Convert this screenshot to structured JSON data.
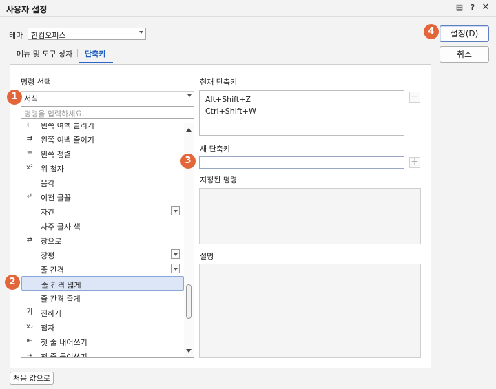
{
  "window": {
    "title": "사용자 설정"
  },
  "theme": {
    "label": "테마",
    "selected": "한컴오피스"
  },
  "tabs": [
    {
      "label": "메뉴 및 도구 상자"
    },
    {
      "label": "단축키"
    }
  ],
  "buttons": {
    "ok_label": "설정(D)",
    "cancel_label": "취소",
    "reset_label": "처음 값으로"
  },
  "left": {
    "command_select_label": "명령 선택",
    "category_selected": "서식",
    "search_placeholder": "명령을 입력하세요.",
    "commands": [
      {
        "label": "왼쪽 여백 늘리기",
        "icon": "indent-left-increase-icon",
        "glyph": "⇇",
        "dropdown": false
      },
      {
        "label": "왼쪽 여백 줄이기",
        "icon": "indent-left-decrease-icon",
        "glyph": "⇉",
        "dropdown": false
      },
      {
        "label": "왼쪽 정렬",
        "icon": "align-left-icon",
        "glyph": "≡",
        "dropdown": false
      },
      {
        "label": "위 첨자",
        "icon": "superscript-icon",
        "glyph": "x²",
        "dropdown": false
      },
      {
        "label": "음각",
        "icon": "",
        "glyph": "",
        "dropdown": false
      },
      {
        "label": "이전 글꼴",
        "icon": "previous-font-icon",
        "glyph": "↵",
        "dropdown": false
      },
      {
        "label": "자간",
        "icon": "",
        "glyph": "",
        "dropdown": true
      },
      {
        "label": "자주 글자 색",
        "icon": "",
        "glyph": "",
        "dropdown": false
      },
      {
        "label": "장으로",
        "icon": "to-chapter-icon",
        "glyph": "⇄",
        "dropdown": false
      },
      {
        "label": "장평",
        "icon": "",
        "glyph": "",
        "dropdown": true
      },
      {
        "label": "줄 간격",
        "icon": "",
        "glyph": "",
        "dropdown": true
      },
      {
        "label": "줄 간격 넓게",
        "icon": "",
        "glyph": "",
        "dropdown": false,
        "selected": true
      },
      {
        "label": "줄 간격 좁게",
        "icon": "",
        "glyph": "",
        "dropdown": false
      },
      {
        "label": "진하게",
        "icon": "bold-icon",
        "glyph": "가",
        "dropdown": false
      },
      {
        "label": "첨자",
        "icon": "subscript-icon",
        "glyph": "x₂",
        "dropdown": false
      },
      {
        "label": "첫 줄 내어쓰기",
        "icon": "hanging-indent-icon",
        "glyph": "⇤",
        "dropdown": false
      },
      {
        "label": "첫 줄 들여쓰기",
        "icon": "first-line-indent-icon",
        "glyph": "⇥",
        "dropdown": false
      }
    ]
  },
  "right": {
    "current_label": "현재 단축키",
    "current_shortcuts": [
      "Alt+Shift+Z",
      "Ctrl+Shift+W"
    ],
    "new_label": "새 단축키",
    "new_value": "",
    "assigned_label": "지정된 명령",
    "description_label": "설명"
  },
  "badges": [
    "1",
    "2",
    "3",
    "4"
  ]
}
